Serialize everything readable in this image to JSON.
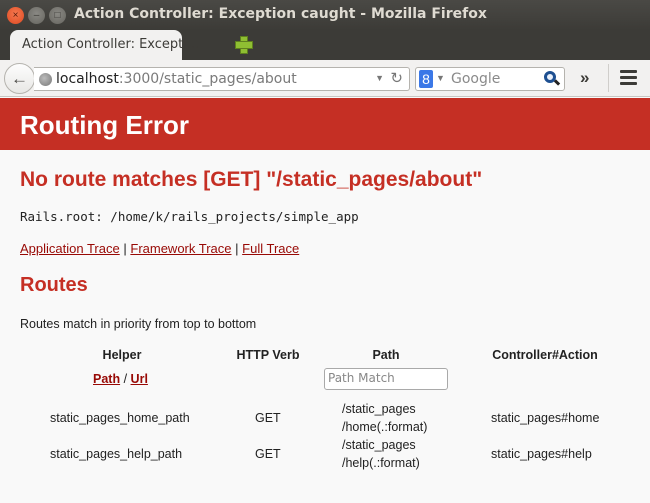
{
  "window": {
    "title": "Action Controller: Exception caught - Mozilla Firefox",
    "controls": {
      "close": "×",
      "minimize": "–",
      "maximize": "□"
    }
  },
  "tabs": [
    {
      "label": "Action Controller: Excepti...",
      "active": true
    }
  ],
  "navbar": {
    "url_host": "localhost",
    "url_rest": ":3000/static_pages/about",
    "search_engine": "Google",
    "search_placeholder": "Google",
    "icons": [
      "back-arrow-icon",
      "globe-icon",
      "dropdown-icon",
      "reload-icon",
      "google-icon",
      "search-icon",
      "overflow-chevrons-icon",
      "hamburger-menu-icon"
    ]
  },
  "page": {
    "banner_title": "Routing Error",
    "error_message": "No route matches [GET] \"/static_pages/about\"",
    "rails_root": "Rails.root: /home/k/rails_projects/simple_app",
    "trace_links": [
      "Application Trace",
      "Framework Trace",
      "Full Trace"
    ],
    "trace_separator": "|",
    "routes_heading": "Routes",
    "routes_description": "Routes match in priority from top to bottom",
    "accent_color": "#c52f24",
    "link_color": "#980905",
    "table": {
      "headers": [
        "Helper",
        "HTTP Verb",
        "Path",
        "Controller#Action"
      ],
      "helper_toggle": {
        "path": "Path",
        "separator": "/",
        "url": "Url"
      },
      "path_filter_placeholder": "Path Match",
      "rows": [
        {
          "helper": "static_pages_home_path",
          "verb": "GET",
          "path_line1": "/static_pages",
          "path_line2": "/home(.:format)",
          "action": "static_pages#home"
        },
        {
          "helper": "static_pages_help_path",
          "verb": "GET",
          "path_line1": "/static_pages",
          "path_line2": "/help(.:format)",
          "action": "static_pages#help"
        }
      ]
    }
  }
}
